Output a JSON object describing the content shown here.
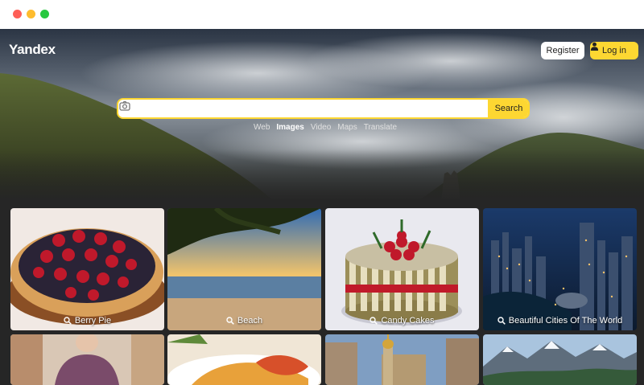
{
  "window": {
    "controls": [
      "close",
      "minimize",
      "maximize"
    ]
  },
  "header": {
    "logo": "Yandex",
    "register_label": "Register",
    "login_label": "Log in"
  },
  "search": {
    "value": "",
    "placeholder": "",
    "button_label": "Search",
    "camera_icon": "camera-icon"
  },
  "services": [
    {
      "label": "Web",
      "active": false
    },
    {
      "label": "Images",
      "active": true
    },
    {
      "label": "Video",
      "active": false
    },
    {
      "label": "Maps",
      "active": false
    },
    {
      "label": "Translate",
      "active": false
    }
  ],
  "gallery": [
    {
      "label": "Berry Pie",
      "icon": "search-icon"
    },
    {
      "label": "Beach",
      "icon": "search-icon"
    },
    {
      "label": "Candy Cakes",
      "icon": "search-icon"
    },
    {
      "label": "Beautiful Cities Of The World",
      "icon": "search-icon"
    },
    {
      "label": "",
      "icon": ""
    },
    {
      "label": "",
      "icon": ""
    },
    {
      "label": "",
      "icon": ""
    },
    {
      "label": "",
      "icon": ""
    }
  ],
  "colors": {
    "accent": "#fdd732",
    "background": "#262626",
    "text": "#ffffff"
  }
}
